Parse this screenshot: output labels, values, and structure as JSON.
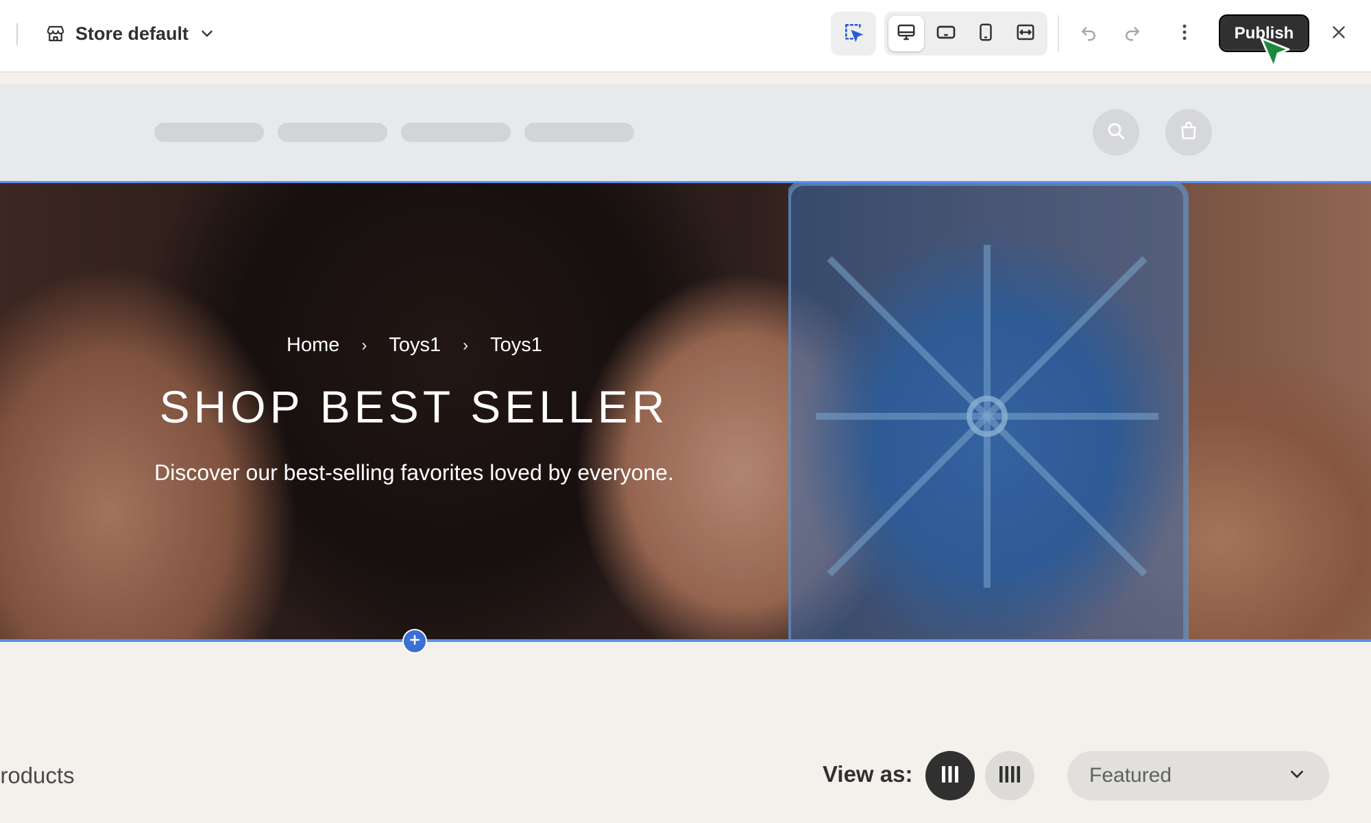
{
  "editor": {
    "store_selector": {
      "label": "Store default",
      "icon": "store-icon"
    },
    "tools": {
      "select_icon": "select-element-icon",
      "devices": [
        {
          "name": "desktop",
          "icon": "desktop-icon",
          "active": true
        },
        {
          "name": "tablet",
          "icon": "tablet-icon",
          "active": false
        },
        {
          "name": "mobile",
          "icon": "mobile-icon",
          "active": false
        },
        {
          "name": "full-width",
          "icon": "expand-width-icon",
          "active": false
        }
      ]
    },
    "undo_icon": "undo-icon",
    "redo_icon": "redo-icon",
    "more_icon": "more-vertical-icon",
    "publish_label": "Publish",
    "close_icon": "close-icon"
  },
  "store_header": {
    "nav_placeholders": 4,
    "search_icon": "search-icon",
    "cart_icon": "shopping-bag-icon"
  },
  "hero": {
    "breadcrumb": [
      "Home",
      "Toys1",
      "Toys1"
    ],
    "breadcrumb_separator": "›",
    "title": "SHOP BEST SELLER",
    "subtitle": "Discover our best-selling favorites loved by everyone.",
    "add_section_icon": "plus-icon"
  },
  "collection_toolbar": {
    "count_label": "products",
    "view_as_label": "View as:",
    "view_options": [
      {
        "name": "3-columns",
        "active": true
      },
      {
        "name": "4-columns",
        "active": false
      }
    ],
    "sort_value": "Featured"
  },
  "colors": {
    "accent_blue": "#5b8def",
    "publish_bg": "#303030",
    "cursor_green": "#1a8a3c",
    "page_bg": "#f4f1ed"
  }
}
